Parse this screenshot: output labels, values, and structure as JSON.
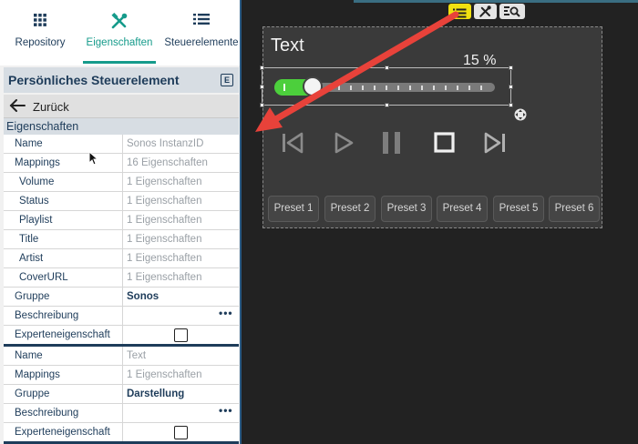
{
  "tabs": [
    {
      "label": "Repository",
      "icon": "grid-icon"
    },
    {
      "label": "Eigenschaften",
      "icon": "tools-icon",
      "active": true
    },
    {
      "label": "Steuerelemente",
      "icon": "list-icon"
    }
  ],
  "panel": {
    "title": "Persönliches Steuerelement",
    "badge": "E"
  },
  "back_label": "Zurück",
  "section_title": "Eigenschaften",
  "props1": [
    {
      "key": "Name",
      "value": "Sonos InstanzID"
    },
    {
      "key": "Mappings",
      "value": "16 Eigenschaften"
    },
    {
      "key": "Volume",
      "value": "1 Eigenschaften"
    },
    {
      "key": "Status",
      "value": "1 Eigenschaften"
    },
    {
      "key": "Playlist",
      "value": "1 Eigenschaften"
    },
    {
      "key": "Title",
      "value": "1 Eigenschaften"
    },
    {
      "key": "Artist",
      "value": "1 Eigenschaften"
    },
    {
      "key": "CoverURL",
      "value": "1 Eigenschaften"
    },
    {
      "key": "Gruppe",
      "value": "Sonos"
    },
    {
      "key": "Beschreibung",
      "value": "•••"
    },
    {
      "key": "Experteneigenschaft",
      "value": ""
    }
  ],
  "props2": [
    {
      "key": "Name",
      "value": "Text"
    },
    {
      "key": "Mappings",
      "value": "1 Eigenschaften"
    },
    {
      "key": "Gruppe",
      "value": "Darstellung"
    },
    {
      "key": "Beschreibung",
      "value": "•••"
    },
    {
      "key": "Experteneigenschaft",
      "value": ""
    }
  ],
  "widget": {
    "title": "Text",
    "percent_label": "15 %",
    "volume_fraction": 0.15,
    "presets": [
      "Preset 1",
      "Preset 2",
      "Preset 3",
      "Preset 4",
      "Preset 5",
      "Preset 6"
    ]
  },
  "colors": {
    "accent": "#169b8b",
    "slider_fill": "#4ccf3c",
    "arrow": "#e8423a",
    "toolbar_active": "#f0e010"
  }
}
